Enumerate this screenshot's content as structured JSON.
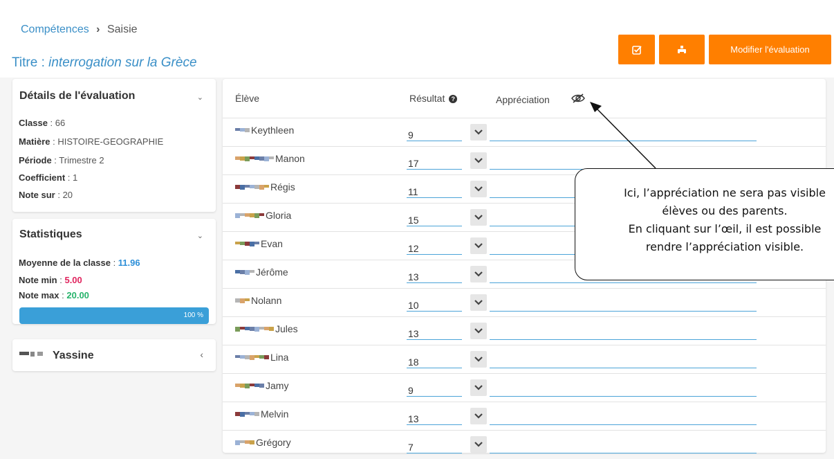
{
  "breadcrumb": {
    "parent": "Compétences",
    "separator": "›",
    "current": "Saisie"
  },
  "title": {
    "label": "Titre : ",
    "value": "interrogation sur la Grèce"
  },
  "toolbar": {
    "modify_label": "Modifier l'évaluation"
  },
  "details": {
    "heading": "Détails de l'évaluation",
    "classe_label": "Classe",
    "classe_value": "66",
    "matiere_label": "Matière",
    "matiere_value": "HISTOIRE-GEOGRAPHIE",
    "periode_label": "Période",
    "periode_value": "Trimestre 2",
    "coef_label": "Coefficient",
    "coef_value": "1",
    "note_sur_label": "Note sur",
    "note_sur_value": "20"
  },
  "stats": {
    "heading": "Statistiques",
    "moyenne_label": "Moyenne de la classe",
    "moyenne_value": "11.96",
    "min_label": "Note min",
    "min_value": "5.00",
    "max_label": "Note max",
    "max_value": "20.00",
    "progress_text": "100 %",
    "progress_fraction": 1.0
  },
  "student_card": {
    "name": "Yassine"
  },
  "table": {
    "col_student": "Élève",
    "col_result": "Résultat",
    "col_appreciation": "Appréciation",
    "rows": [
      {
        "name": "Keythleen",
        "result": "9"
      },
      {
        "name": "Manon",
        "result": "17"
      },
      {
        "name": "Régis",
        "result": "11"
      },
      {
        "name": "Gloria",
        "result": "15"
      },
      {
        "name": "Evan",
        "result": "12"
      },
      {
        "name": "Jérôme",
        "result": "13"
      },
      {
        "name": "Nolann",
        "result": "10"
      },
      {
        "name": "Jules",
        "result": "13"
      },
      {
        "name": "Lina",
        "result": "18"
      },
      {
        "name": "Jamy",
        "result": "9"
      },
      {
        "name": "Melvin",
        "result": "13"
      },
      {
        "name": "Grégory",
        "result": "7"
      }
    ]
  },
  "callout": {
    "line1": "Ici, l’appréciation ne sera pas visible",
    "line2": "élèves ou des parents.",
    "line3": "En cliquant sur l’œil, il est possible",
    "line4": "rendre l’appréciation visible."
  },
  "colors": {
    "accent": "#ff7f00",
    "link": "#3a8fc7",
    "progress": "#3a9fd8"
  },
  "icons": [
    "check-square-icon",
    "print-icon",
    "chevron-down-icon",
    "chevron-left-icon",
    "help-icon",
    "eye-slash-icon"
  ]
}
